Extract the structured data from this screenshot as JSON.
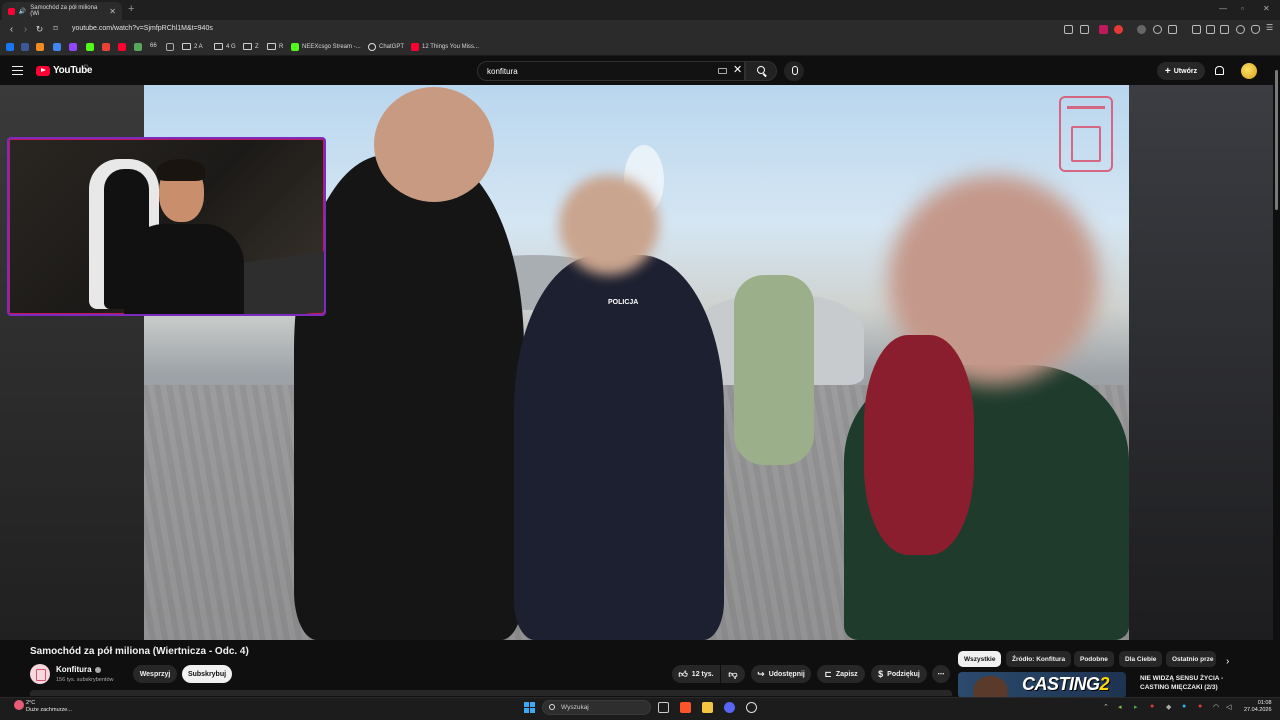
{
  "browser": {
    "tab_title": "Samochód za pół miliona (Wi",
    "url": "youtube.com/watch?v=SjmfpRChl1M&t=940s",
    "bookmarks": [
      "2 A",
      "4 G",
      "Z",
      "R",
      "NEEXcsgo Stream -...",
      "ChatGPT",
      "12 Things You Miss..."
    ],
    "bookmark_prefix": "66"
  },
  "youtube": {
    "logo_text": "YouTube",
    "region": "PL",
    "search_value": "konfitura",
    "create_label": "Utwórz"
  },
  "video": {
    "title": "Samochód za pół miliona (Wiertnicza - Odc. 4)",
    "channel_name": "Konfitura",
    "subscribers": "156 tys. subskrybentów",
    "support_label": "Wesprzyj",
    "subscribe_label": "Subskrybuj",
    "likes": "12 tys.",
    "share_label": "Udostępnij",
    "save_label": "Zapisz",
    "thanks_label": "Podziękuj",
    "sign_text": "POLICJA"
  },
  "chips": [
    "Wszystkie",
    "Źródło: Konfitura",
    "Podobne",
    "Dla Ciebie",
    "Ostatnio prze"
  ],
  "recommendation": {
    "thumb_text": "CASTING",
    "thumb_num": "2",
    "title": "NIE WIDZĄ SENSU ŻYCIA - CASTING MIĘCZAKI (2/3)"
  },
  "taskbar": {
    "weather_temp": "2°C",
    "weather_desc": "Duże zachmurze...",
    "search_placeholder": "Wyszukaj",
    "time": "01:08",
    "date": "27.04.2026"
  },
  "colors": {
    "yt_red": "#ff0033",
    "bg": "#0f0f0f",
    "cam_border": "#7b2cbf",
    "brand_pink": "#d9536f"
  }
}
